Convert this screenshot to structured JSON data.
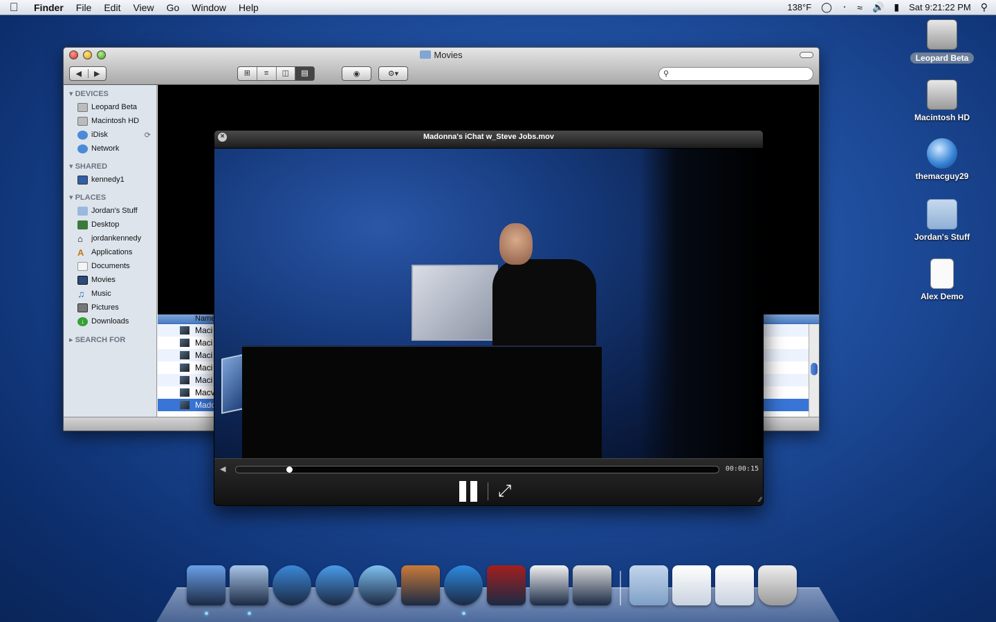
{
  "menubar": {
    "app_name": "Finder",
    "menus": [
      "File",
      "Edit",
      "View",
      "Go",
      "Window",
      "Help"
    ],
    "temperature": "138°F",
    "clock": "Sat 9:21:22 PM"
  },
  "desktop_icons": [
    {
      "label": "Leopard Beta",
      "kind": "hard-drive",
      "selected": true
    },
    {
      "label": "Macintosh HD",
      "kind": "hard-drive",
      "selected": false
    },
    {
      "label": "themacguy29",
      "kind": "network-globe",
      "selected": false
    },
    {
      "label": "Jordan's Stuff",
      "kind": "folder",
      "selected": false
    },
    {
      "label": "Alex Demo",
      "kind": "document",
      "selected": false
    }
  ],
  "finder": {
    "title": "Movies",
    "sidebar": {
      "devices_header": "DEVICES",
      "devices": [
        "Leopard Beta",
        "Macintosh HD",
        "iDisk",
        "Network"
      ],
      "shared_header": "SHARED",
      "shared": [
        "kennedy1"
      ],
      "places_header": "PLACES",
      "places": [
        "Jordan's Stuff",
        "Desktop",
        "jordankennedy",
        "Applications",
        "Documents",
        "Movies",
        "Music",
        "Pictures",
        "Downloads"
      ],
      "search_header": "SEARCH FOR"
    },
    "list": {
      "column_name": "Name",
      "rows": [
        "Maci",
        "Maci",
        "Maci",
        "Maci",
        "Maci",
        "Macv",
        "Mado"
      ]
    }
  },
  "quicktime": {
    "title": "Madonna's iChat w_Steve Jobs.mov",
    "timecode": "00:00:15",
    "progress": 0.11
  },
  "dock": {
    "apps": [
      "finder-icon",
      "mail-icon",
      "safari-icon",
      "ichat-icon",
      "itunes-icon",
      "iphoto-icon",
      "quicktime-icon",
      "photo-booth-icon",
      "front-row-icon",
      "boot-camp-icon"
    ],
    "stacks": [
      "applications-stack-icon",
      "documents-stack-icon",
      "downloads-stack-icon",
      "trash-icon"
    ],
    "colors": {
      "finder": "#6aa0e8",
      "mail": "#a9c6e8",
      "safari": "#3b87d6",
      "ichat": "#4a9ae8",
      "itunes": "#7fc0f0",
      "iphoto": "#c97a3a",
      "quicktime": "#2e8ae0",
      "photo_booth": "#a21f1f",
      "front_row": "#f2f2f2",
      "boot_camp": "#dcdcdc"
    }
  }
}
